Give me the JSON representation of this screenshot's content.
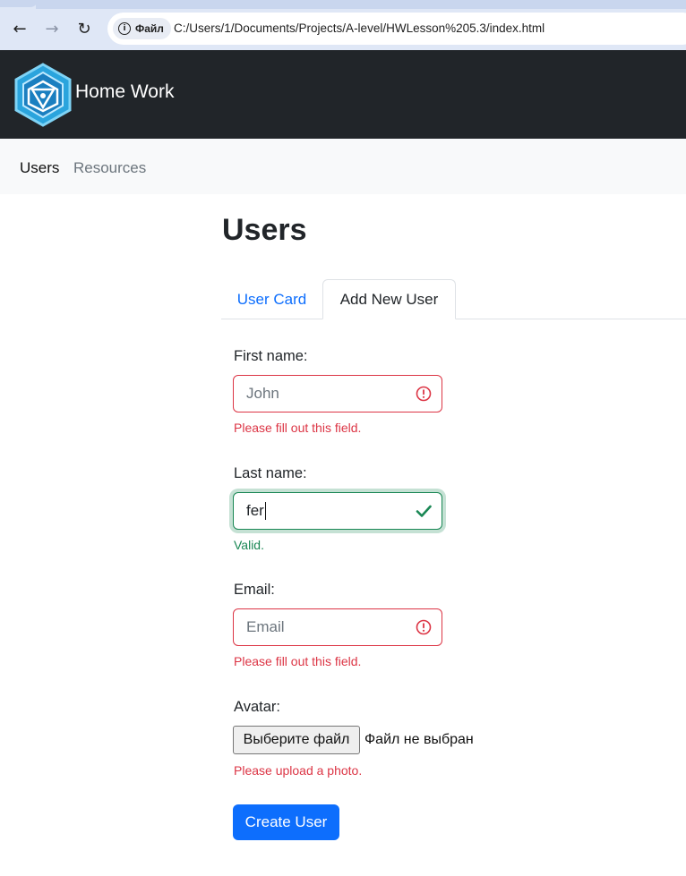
{
  "browser": {
    "back_icon": "←",
    "forward_icon": "→",
    "reload_icon": "↻",
    "site_info_label": "Файл",
    "url": "C:/Users/1/Documents/Projects/A-level/HWLesson%205.3/index.html"
  },
  "header": {
    "brand": "Home Work"
  },
  "subnav": {
    "items": [
      {
        "label": "Users"
      },
      {
        "label": "Resources"
      }
    ]
  },
  "page": {
    "title": "Users"
  },
  "tabs": [
    {
      "label": "User Card"
    },
    {
      "label": "Add New User"
    }
  ],
  "form": {
    "first_name": {
      "label": "First name:",
      "placeholder": "John",
      "value": "",
      "feedback": "Please fill out this field."
    },
    "last_name": {
      "label": "Last name:",
      "value": "fer",
      "feedback": "Valid."
    },
    "email": {
      "label": "Email:",
      "placeholder": "Email",
      "value": "",
      "feedback": "Please fill out this field."
    },
    "avatar": {
      "label": "Avatar:",
      "button_label": "Выберите файл",
      "status": "Файл не выбран",
      "feedback": "Please upload a photo."
    },
    "submit_label": "Create User"
  },
  "colors": {
    "primary": "#0d6efd",
    "danger": "#dc3545",
    "success": "#198754",
    "header_bg": "#212529"
  }
}
